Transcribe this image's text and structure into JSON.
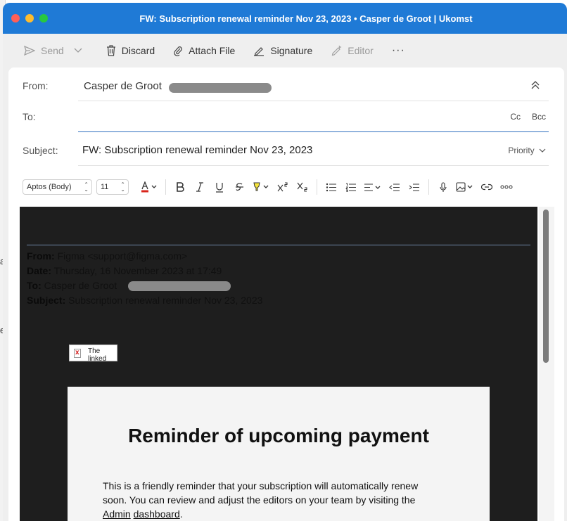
{
  "window": {
    "title": "FW: Subscription renewal reminder Nov 23, 2023 • Casper de Groot | Ukomst"
  },
  "background": {
    "frag1": "a",
    "frag2": "e"
  },
  "toolbar": {
    "send": "Send",
    "discard": "Discard",
    "attach": "Attach File",
    "signature": "Signature",
    "editor": "Editor",
    "more": "···"
  },
  "header": {
    "from_label": "From:",
    "from_value": "Casper de Groot",
    "to_label": "To:",
    "to_value": "",
    "cc": "Cc",
    "bcc": "Bcc",
    "subject_label": "Subject:",
    "subject_value": "FW: Subscription renewal reminder Nov 23, 2023",
    "priority": "Priority"
  },
  "format": {
    "font": "Aptos (Body)",
    "size": "11"
  },
  "forwarded": {
    "from_label": "From:",
    "from_value": "Figma <support@figma.com>",
    "date_label": "Date:",
    "date_value": "Thursday, 16 November 2023 at 17:49",
    "to_label": "To:",
    "to_value": "Casper de Groot",
    "subject_label": "Subject:",
    "subject_value": "Subscription renewal reminder Nov 23, 2023"
  },
  "broken_image": {
    "alt_line1": "The",
    "alt_line2": "linked"
  },
  "email": {
    "heading": "Reminder of upcoming payment",
    "para_1": "This is a friendly reminder that your subscription will automatically renew soon. You can review and adjust the editors on your team by visiting the ",
    "link_1": "Admin",
    "link_2": "dashboard",
    "para_end": "."
  },
  "colors": {
    "titlebar": "#1f7ad6",
    "body_bg": "#1e1e1e",
    "accent_line": "#2e6fbf"
  }
}
